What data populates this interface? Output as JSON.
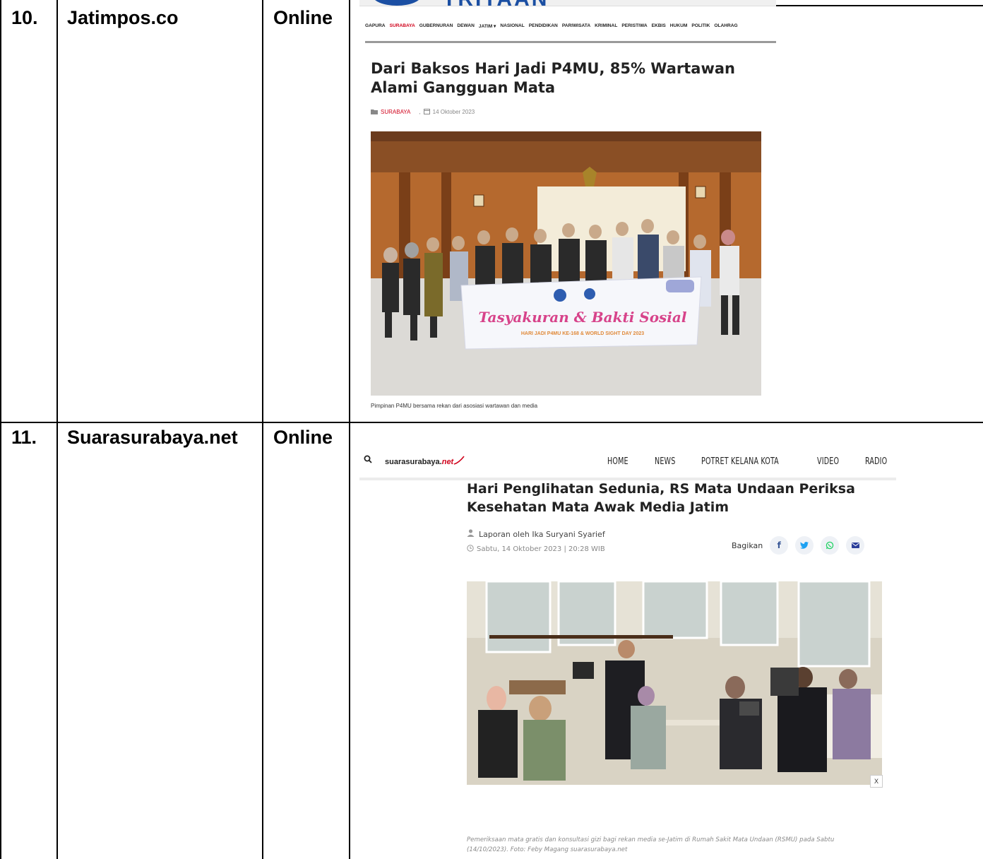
{
  "rows": [
    {
      "number": "10.",
      "outlet": "Jatimpos.co",
      "medium": "Online",
      "screenshot": {
        "logo_text": "TRITAAN",
        "nav": [
          "GAPURA",
          "SURABAYA",
          "GUBERNURAN",
          "DEWAN",
          "JATIM ▾",
          "NASIONAL",
          "PENDIDIKAN",
          "PARIWISATA",
          "KRIMINAL",
          "PERISTIWA",
          "EKBIS",
          "HUKUM",
          "POLITIK",
          "OLAHRAG"
        ],
        "active_nav_index": 1,
        "title": "Dari Baksos Hari Jadi P4MU, 85% Wartawan Alami Gangguan Mata",
        "category": "SURABAYA",
        "separator": ",",
        "date": "14 Oktober 2023",
        "banner_text": "Tasyakuran & Bakti Sosial",
        "banner_subtext": "HARI JADI P4MU KE-168 & WORLD SIGHT DAY 2023",
        "caption": "Pimpinan P4MU bersama rekan dari asosiasi wartawan dan media"
      }
    },
    {
      "number": "11.",
      "outlet": "Suarasurabaya.net",
      "medium": "Online",
      "screenshot": {
        "logo_main": "suarasurabaya.",
        "logo_suffix": "net",
        "nav": [
          "HOME",
          "NEWS",
          "POTRET KELANA KOTA",
          "VIDEO",
          "RADIO"
        ],
        "title": "Hari Penglihatan Sedunia, RS Mata Undaan Periksa Kesehatan Mata Awak Media Jatim",
        "author": "Laporan oleh Ika Suryani Syarief",
        "date": "Sabtu, 14 Oktober 2023 | 20:28 WIB",
        "share_label": "Bagikan",
        "share_icons": [
          "f",
          "t",
          "w",
          "m"
        ],
        "close_label": "X",
        "caption": "Pemeriksaan mata gratis dan konsultasi gizi bagi rekan media se-Jatim di Rumah Sakit Mata Undaan (RSMU) pada Sabtu (14/10/2023). Foto: Feby Magang suarasurabaya.net"
      }
    }
  ],
  "colors": {
    "accent_red": "#d0021b",
    "brand_blue": "#1b4fa3",
    "facebook": "#3b5998",
    "twitter": "#1da1f2",
    "whatsapp": "#25d366",
    "mail": "#2c3e9a"
  }
}
